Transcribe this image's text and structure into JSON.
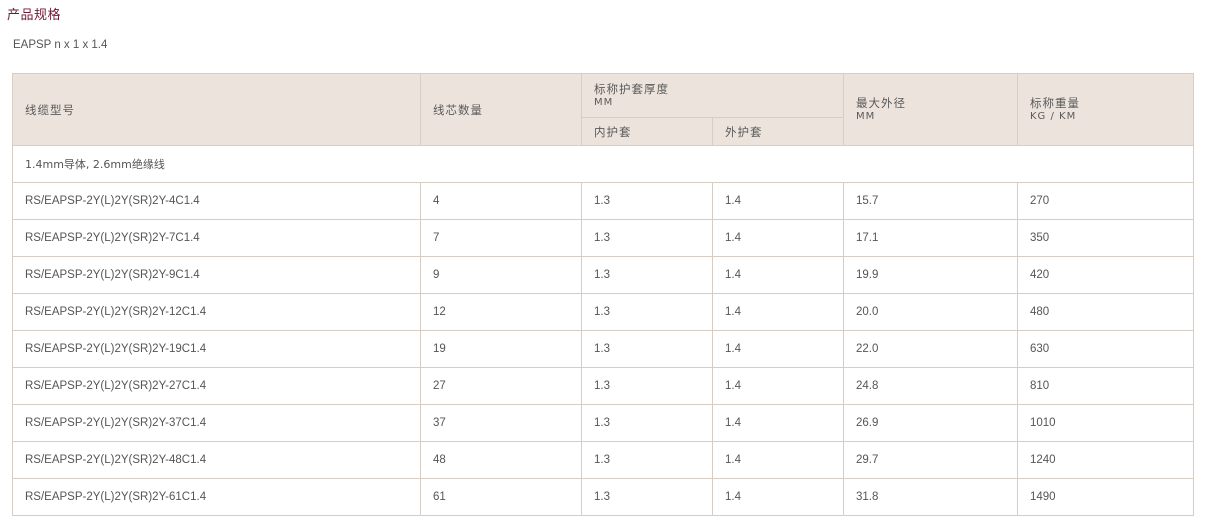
{
  "page": {
    "section_title": "产品规格",
    "subtitle": "EAPSP n x 1 x 1.4"
  },
  "table": {
    "headers": {
      "cable_type": "线缆型号",
      "core_count": "线芯数量",
      "sheath_thickness": "标称护套厚度",
      "sheath_thickness_unit": "MM",
      "inner_sheath": "内护套",
      "outer_sheath": "外护套",
      "max_od": "最大外径",
      "max_od_unit": "MM",
      "weight": "标称重量",
      "weight_unit": "KG / KM"
    },
    "group_label": "1.4mm导体, 2.6mm绝缘线",
    "rows": [
      [
        "RS/EAPSP-2Y(L)2Y(SR)2Y-4C1.4",
        "4",
        "1.3",
        "1.4",
        "15.7",
        "270"
      ],
      [
        "RS/EAPSP-2Y(L)2Y(SR)2Y-7C1.4",
        "7",
        "1.3",
        "1.4",
        "17.1",
        "350"
      ],
      [
        "RS/EAPSP-2Y(L)2Y(SR)2Y-9C1.4",
        "9",
        "1.3",
        "1.4",
        "19.9",
        "420"
      ],
      [
        "RS/EAPSP-2Y(L)2Y(SR)2Y-12C1.4",
        "12",
        "1.3",
        "1.4",
        "20.0",
        "480"
      ],
      [
        "RS/EAPSP-2Y(L)2Y(SR)2Y-19C1.4",
        "19",
        "1.3",
        "1.4",
        "22.0",
        "630"
      ],
      [
        "RS/EAPSP-2Y(L)2Y(SR)2Y-27C1.4",
        "27",
        "1.3",
        "1.4",
        "24.8",
        "810"
      ],
      [
        "RS/EAPSP-2Y(L)2Y(SR)2Y-37C1.4",
        "37",
        "1.3",
        "1.4",
        "26.9",
        "1010"
      ],
      [
        "RS/EAPSP-2Y(L)2Y(SR)2Y-48C1.4",
        "48",
        "1.3",
        "1.4",
        "29.7",
        "1240"
      ],
      [
        "RS/EAPSP-2Y(L)2Y(SR)2Y-61C1.4",
        "61",
        "1.3",
        "1.4",
        "31.8",
        "1490"
      ]
    ]
  }
}
